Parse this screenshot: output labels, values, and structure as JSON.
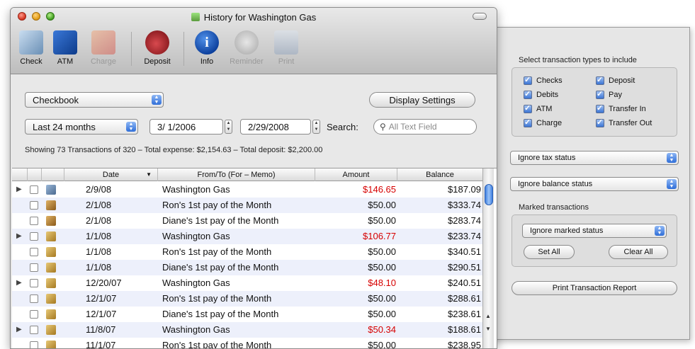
{
  "window": {
    "title": "History for Washington Gas"
  },
  "toolbar": [
    {
      "label": "Check",
      "icon": "check-icon",
      "enabled": true
    },
    {
      "label": "ATM",
      "icon": "atm-icon",
      "enabled": true
    },
    {
      "label": "Charge",
      "icon": "charge-card-icon",
      "enabled": false
    },
    {
      "label": "Deposit",
      "icon": "piggy-bank-icon",
      "enabled": true
    },
    {
      "label": "Info",
      "icon": "info-icon",
      "enabled": true
    },
    {
      "label": "Reminder",
      "icon": "alarm-clock-icon",
      "enabled": false
    },
    {
      "label": "Print",
      "icon": "printer-icon",
      "enabled": false
    }
  ],
  "filters": {
    "account": "Checkbook",
    "display_settings": "Display Settings",
    "period": "Last 24 months",
    "start_date": "3/ 1/2006",
    "end_date": "2/29/2008",
    "search_label": "Search:",
    "search_placeholder": "All Text Field",
    "summary": "Showing 73 Transactions of 320 – Total expense: $2,154.63 – Total deposit: $2,200.00"
  },
  "table": {
    "columns": [
      "Date",
      "From/To  (For – Memo)",
      "Amount",
      "Balance"
    ],
    "rows": [
      {
        "expand": true,
        "icon": "car",
        "date": "2/9/08",
        "payee": "Washington Gas",
        "amount": "$146.65",
        "negative": true,
        "balance": "$187.09"
      },
      {
        "expand": false,
        "icon": "deposit",
        "date": "2/1/08",
        "payee": "Ron's 1st pay of the Month",
        "amount": "$50.00",
        "negative": false,
        "balance": "$333.74"
      },
      {
        "expand": false,
        "icon": "deposit",
        "date": "2/1/08",
        "payee": "Diane's 1st pay of the Month",
        "amount": "$50.00",
        "negative": false,
        "balance": "$283.74"
      },
      {
        "expand": true,
        "icon": "scale",
        "date": "1/1/08",
        "payee": "Washington Gas",
        "amount": "$106.77",
        "negative": true,
        "balance": "$233.74"
      },
      {
        "expand": false,
        "icon": "scale",
        "date": "1/1/08",
        "payee": "Ron's 1st pay of the Month",
        "amount": "$50.00",
        "negative": false,
        "balance": "$340.51"
      },
      {
        "expand": false,
        "icon": "scale",
        "date": "1/1/08",
        "payee": "Diane's 1st pay of the Month",
        "amount": "$50.00",
        "negative": false,
        "balance": "$290.51"
      },
      {
        "expand": true,
        "icon": "scale",
        "date": "12/20/07",
        "payee": "Washington Gas",
        "amount": "$48.10",
        "negative": true,
        "balance": "$240.51"
      },
      {
        "expand": false,
        "icon": "scale",
        "date": "12/1/07",
        "payee": "Ron's 1st pay of the Month",
        "amount": "$50.00",
        "negative": false,
        "balance": "$288.61"
      },
      {
        "expand": false,
        "icon": "scale",
        "date": "12/1/07",
        "payee": "Diane's 1st pay of the Month",
        "amount": "$50.00",
        "negative": false,
        "balance": "$238.61"
      },
      {
        "expand": true,
        "icon": "scale",
        "date": "11/8/07",
        "payee": "Washington Gas",
        "amount": "$50.34",
        "negative": true,
        "balance": "$188.61"
      },
      {
        "expand": false,
        "icon": "scale",
        "date": "11/1/07",
        "payee": "Ron's 1st pay of the Month",
        "amount": "$50.00",
        "negative": false,
        "balance": "$238.95"
      }
    ]
  },
  "drawer": {
    "types_title": "Select transaction types to include",
    "types": [
      "Checks",
      "Deposit",
      "Debits",
      "Pay",
      "ATM",
      "Transfer In",
      "Charge",
      "Transfer Out"
    ],
    "tax_status": "Ignore tax status",
    "balance_status": "Ignore balance status",
    "marked_title": "Marked transactions",
    "marked_status": "Ignore marked status",
    "set_all": "Set All",
    "clear_all": "Clear All",
    "print_report": "Print Transaction Report"
  },
  "colors": {
    "negative_amount": "#d60000",
    "accent": "#2f6ed8",
    "row_alt": "#edf0fb"
  }
}
